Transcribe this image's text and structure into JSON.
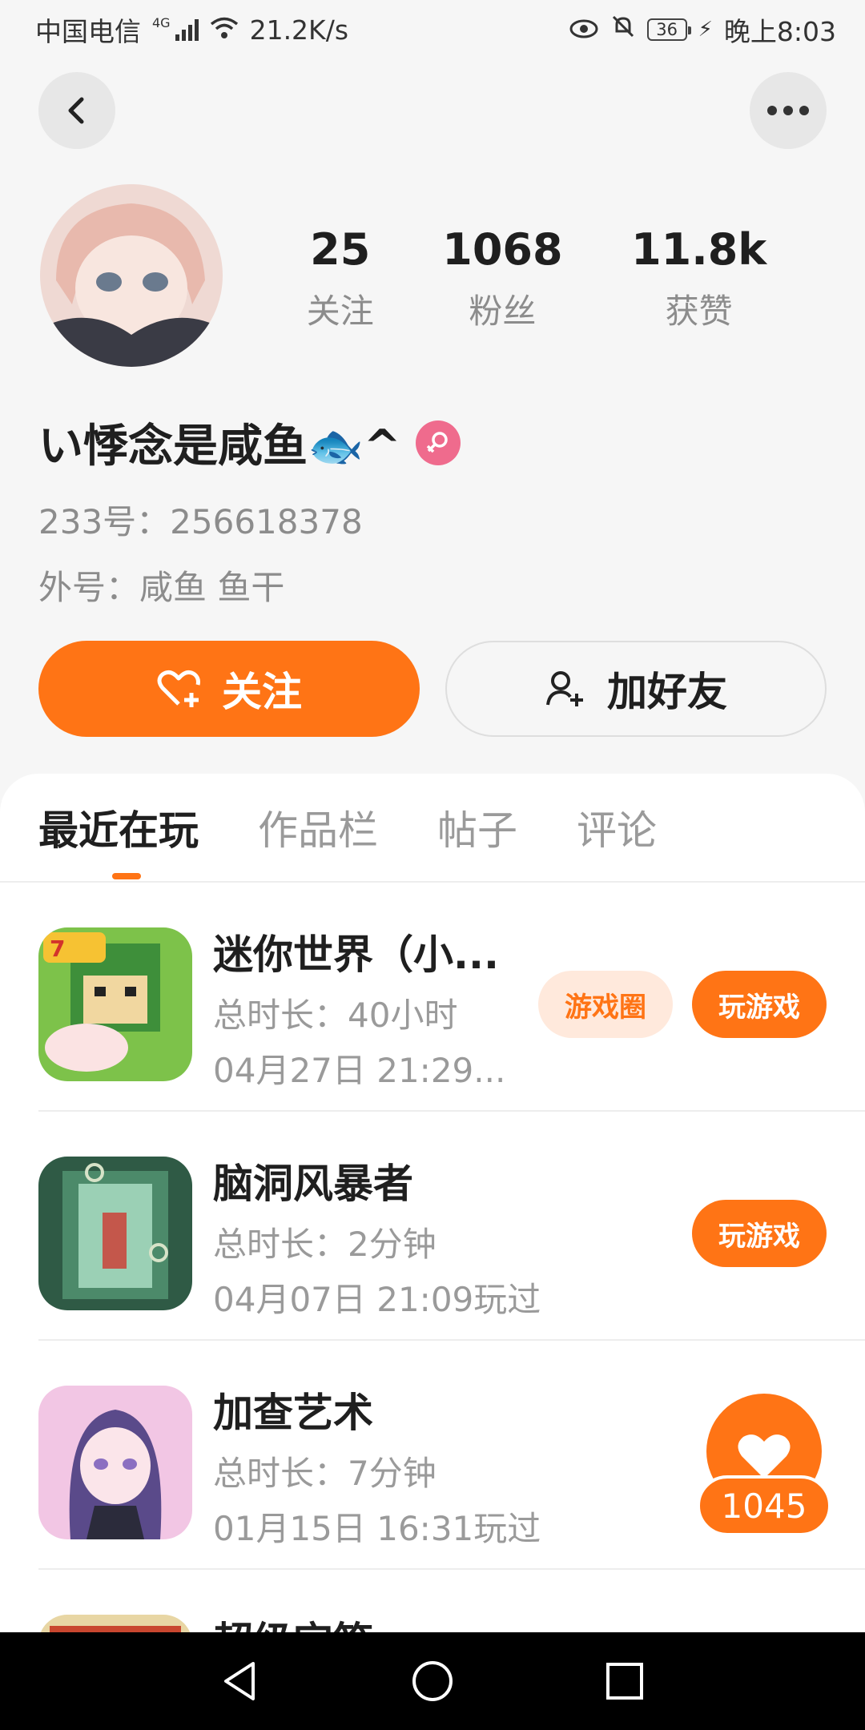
{
  "status_bar": {
    "carrier": "中国电信",
    "network": "4G",
    "speed": "21.2K/s",
    "battery": "36",
    "time": "晚上8:03"
  },
  "profile": {
    "stats": [
      {
        "value": "25",
        "label": "关注"
      },
      {
        "value": "1068",
        "label": "粉丝"
      },
      {
        "value": "11.8k",
        "label": "获赞"
      }
    ],
    "username": "い悸念是咸鱼🐟^",
    "id_line": "233号：256618378",
    "alias_line": "外号：咸鱼  鱼干",
    "follow_label": "关注",
    "add_friend_label": "加好友"
  },
  "tabs": [
    "最近在玩",
    "作品栏",
    "帖子",
    "评论"
  ],
  "games": [
    {
      "name": "迷你世界（小...",
      "duration": "总时长：40小时",
      "last_played": "04月27日 21:29...",
      "circle_label": "游戏圈",
      "play_label": "玩游戏"
    },
    {
      "name": "脑洞风暴者",
      "duration": "总时长：2分钟",
      "last_played": "04月07日 21:09玩过",
      "play_label": "玩游戏"
    },
    {
      "name": "加查艺术",
      "duration": "总时长：7分钟",
      "last_played": "01月15日 16:31玩过"
    },
    {
      "name": "超级宝箱"
    }
  ],
  "like_fab": {
    "count": "1045"
  },
  "colors": {
    "accent": "#ff7415",
    "gender_female": "#ef6b8d"
  }
}
